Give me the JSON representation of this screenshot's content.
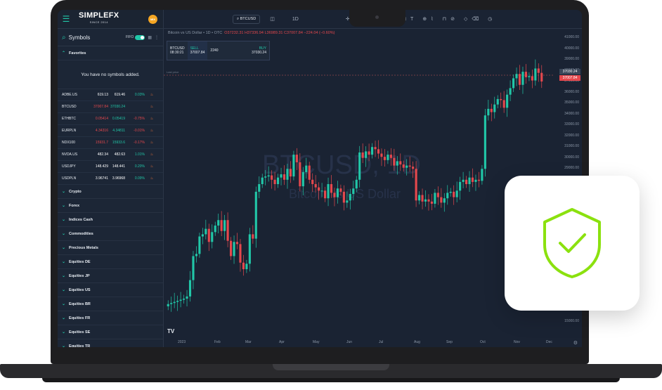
{
  "brand": {
    "name": "SIMPLEFX",
    "tagline": "SINCE 2014",
    "avatar_initials": "MIX",
    "accent": "#21c7a8"
  },
  "sidebar": {
    "title": "Symbols",
    "fifo_label": "FIFO",
    "favorites_label": "Favorites",
    "empty_message": "You have no symbols added.",
    "rows": [
      {
        "symbol": "ADBE.US",
        "bid": "619.13",
        "ask": "619.46",
        "change": "0.03%",
        "trend": "up"
      },
      {
        "symbol": "BTCUSD",
        "bid": "37007.84",
        "ask": "37030.24",
        "change": "",
        "trend": "down"
      },
      {
        "symbol": "ETHBTC",
        "bid": "0.05414",
        "ask": "0.05419",
        "change": "-0.75%",
        "trend": "down"
      },
      {
        "symbol": "EURPLN",
        "bid": "4.34316",
        "ask": "4.34811",
        "change": "-0.01%",
        "trend": "down"
      },
      {
        "symbol": "NDX100",
        "bid": "15931.7",
        "ask": "15933.6",
        "change": "-0.17%",
        "trend": "down"
      },
      {
        "symbol": "NVDA.US",
        "bid": "482.34",
        "ask": "482.63",
        "change": "1.01%",
        "trend": "up"
      },
      {
        "symbol": "USDJPY",
        "bid": "148.429",
        "ask": "148.441",
        "change": "0.20%",
        "trend": "up"
      },
      {
        "symbol": "USDPLN",
        "bid": "3.96741",
        "ask": "3.96968",
        "change": "0.09%",
        "trend": "up"
      }
    ],
    "categories": [
      "Crypto",
      "Forex",
      "Indices Cash",
      "Commodities",
      "Precious Metals",
      "Equities DE",
      "Equities JP",
      "Equities US",
      "Equities BR",
      "Equities FR",
      "Equities SE",
      "Equities TR"
    ]
  },
  "toolbar": {
    "symbol": "BTCUSD",
    "interval": "1D"
  },
  "chart_header": {
    "title": "Bitcoin vs US Dollar • 1D • OTC",
    "ohlc": "O37232.31 H37336.94 L36989.31 C37007.84 −224.04 (−0.60%)"
  },
  "trade": {
    "symbol": "BTCUSD",
    "timer": "08:30:21",
    "sell_label": "SELL",
    "sell": "37007.84",
    "spread": "2240",
    "buy_label": "BUY",
    "buy": "37030.24"
  },
  "watermark": {
    "line1": "BTCUSD, 1D",
    "line2": "Bitcoin vs US Dollar"
  },
  "last_price_label": "Last price",
  "price_tags": {
    "buy": "37030.24",
    "sell": "37007.84"
  },
  "y_ticks": [
    "41000.00",
    "40000.00",
    "39000.00",
    "38000.00",
    "37000.00",
    "36000.00",
    "35000.00",
    "34000.00",
    "33000.00",
    "32000.00",
    "31000.00",
    "30000.00",
    "29000.00",
    "28000.00",
    "27000.00",
    "26000.00",
    "25000.00",
    "24000.00",
    "23000.00",
    "22000.00",
    "21000.00",
    "20000.00",
    "19000.00",
    "18000.00",
    "17000.00",
    "16000.00",
    "15000.00"
  ],
  "x_ticks": [
    "2023",
    "Feb",
    "Mar",
    "Apr",
    "May",
    "Jun",
    "Jul",
    "Aug",
    "Sep",
    "Oct",
    "Nov",
    "Dec"
  ],
  "candles_close": [
    16600,
    16700,
    16800,
    16900,
    17000,
    17100,
    17300,
    18800,
    21000,
    21200,
    22800,
    23000,
    23500,
    22300,
    23200,
    23800,
    24300,
    23300,
    24300,
    22400,
    21000,
    22300,
    22100,
    20400,
    19800,
    20300,
    23000,
    22600,
    26900,
    27600,
    28200,
    28300,
    28400,
    28000,
    27600,
    28200,
    28500,
    28000,
    29000,
    28300,
    30300,
    29600,
    27400,
    28700,
    29300,
    28000,
    27600,
    27300,
    27000,
    27000,
    26300,
    27600,
    26800,
    26400,
    27200,
    26900,
    25900,
    26100,
    26700,
    27200,
    28000,
    30500,
    30000,
    30600,
    30300,
    31000,
    30800,
    30400,
    30100,
    29800,
    30300,
    30000,
    29300,
    29700,
    29400,
    29100,
    29300,
    29200,
    29000,
    26100,
    26600,
    26000,
    26200,
    26000,
    25800,
    26800,
    26400,
    25900,
    26300,
    26800,
    26900,
    26400,
    27000,
    27800,
    28000,
    27600,
    28200,
    27800,
    28000,
    27900,
    29000,
    33900,
    34500,
    34200,
    34900,
    35400,
    35300,
    34600,
    35800,
    36400,
    37300,
    37700,
    36700,
    37900,
    37400,
    37500,
    37100,
    38200,
    37800,
    37008
  ]
}
